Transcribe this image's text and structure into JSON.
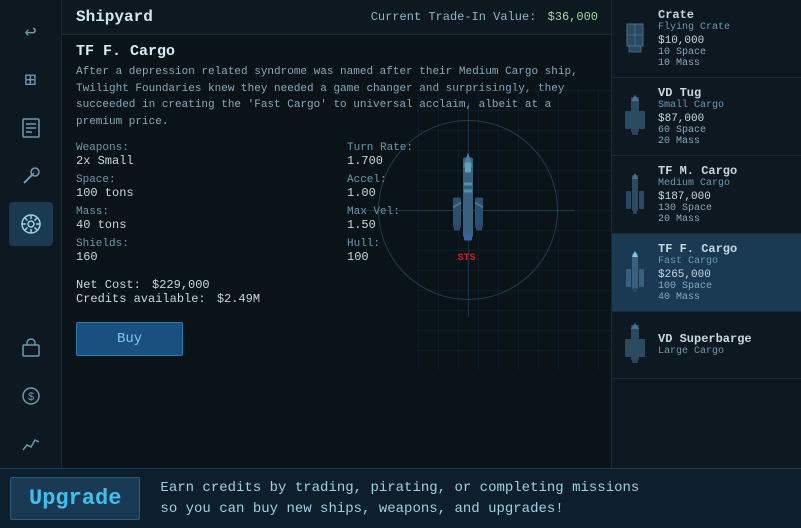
{
  "header": {
    "title": "Shipyard",
    "trade_value_label": "Current Trade-In Value:",
    "trade_value": "$36,000"
  },
  "selected_ship": {
    "name": "TF F. Cargo",
    "description": "After a depression related syndrome was named after their Medium Cargo ship, Twilight Foundaries knew they needed a game changer and surprisingly, they succeeded in creating the 'Fast Cargo' to universal acclaim, albeit at a premium price.",
    "weapons_label": "Weapons:",
    "weapons_value": "2x Small",
    "turn_rate_label": "Turn Rate:",
    "turn_rate_value": "1.700",
    "space_label": "Space:",
    "space_value": "100 tons",
    "accel_label": "Accel:",
    "accel_value": "1.00",
    "mass_label": "Mass:",
    "mass_value": "40 tons",
    "max_vel_label": "Max Vel:",
    "max_vel_value": "1.50",
    "shields_label": "Shields:",
    "shields_value": "160",
    "hull_label": "Hull:",
    "hull_value": "100",
    "net_cost_label": "Net Cost:",
    "net_cost_value": "$229,000",
    "credits_label": "Credits available:",
    "credits_value": "$2.49M",
    "buy_label": "Buy",
    "sts_label": "STS"
  },
  "ship_list": [
    {
      "name": "Crate",
      "type": "Flying Crate",
      "price": "$10,000",
      "space": "10 Space",
      "mass": "10 Mass",
      "selected": false
    },
    {
      "name": "VD Tug",
      "type": "Small Cargo",
      "price": "$87,000",
      "space": "60 Space",
      "mass": "20 Mass",
      "selected": false
    },
    {
      "name": "TF M. Cargo",
      "type": "Medium Cargo",
      "price": "$187,000",
      "space": "130 Space",
      "mass": "20 Mass",
      "selected": false
    },
    {
      "name": "TF F. Cargo",
      "type": "Fast Cargo",
      "price": "$265,000",
      "space": "100 Space",
      "mass": "40 Mass",
      "selected": true
    },
    {
      "name": "VD Superbarge",
      "type": "Large Cargo",
      "price": "",
      "space": "",
      "mass": "",
      "selected": false
    }
  ],
  "sidebar": {
    "icons": [
      {
        "name": "back-icon",
        "symbol": "↩",
        "active": false
      },
      {
        "name": "map-icon",
        "symbol": "⊞",
        "active": false
      },
      {
        "name": "info-icon",
        "symbol": "📋",
        "active": false
      },
      {
        "name": "tools-icon",
        "symbol": "⚙",
        "active": false
      },
      {
        "name": "helm-icon",
        "symbol": "⚓",
        "active": true
      },
      {
        "name": "trade-icon",
        "symbol": "📦",
        "active": false
      },
      {
        "name": "credits-icon",
        "symbol": "$",
        "active": false
      },
      {
        "name": "stats-icon",
        "symbol": "📈",
        "active": false
      }
    ]
  },
  "bottom_bar": {
    "upgrade_label": "Upgrade",
    "tip_text": "Earn credits by trading, pirating, or completing missions\nso you can buy new ships, weapons, and upgrades!"
  }
}
